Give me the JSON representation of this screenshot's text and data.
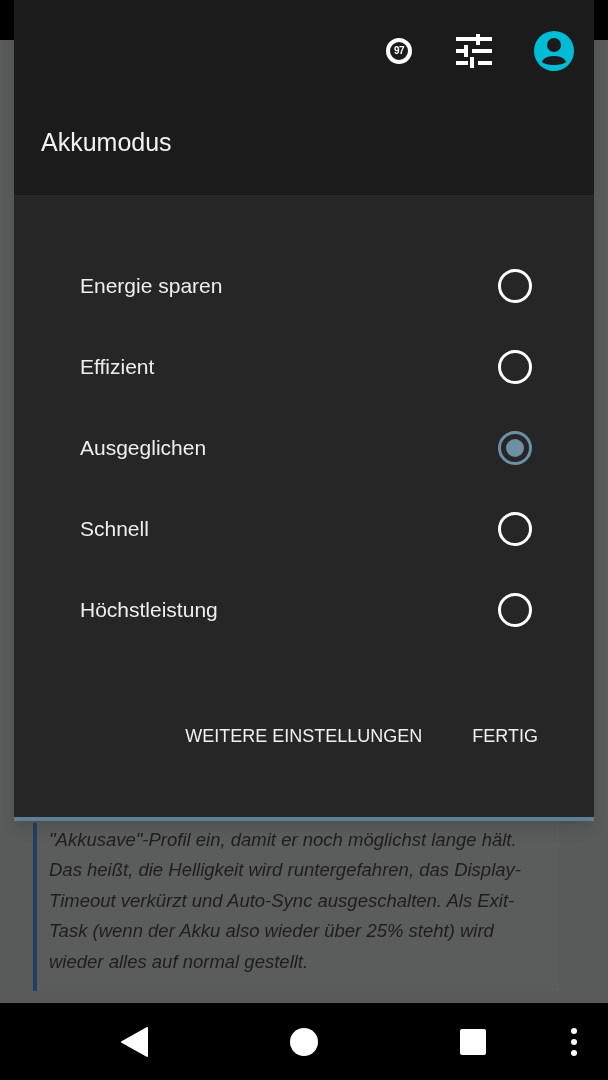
{
  "header": {
    "battery_badge": "97",
    "title": "Akkumodus"
  },
  "options": [
    {
      "label": "Energie sparen",
      "selected": false
    },
    {
      "label": "Effizient",
      "selected": false
    },
    {
      "label": "Ausgeglichen",
      "selected": true
    },
    {
      "label": "Schnell",
      "selected": false
    },
    {
      "label": "Höchstleistung",
      "selected": false
    }
  ],
  "buttons": [
    "WEITERE EINSTELLUNGEN",
    "FERTIG"
  ],
  "background_text": "\"Akkusave\"-Profil ein, damit er noch möglichst lange hält. Das heißt, die Helligkeit wird runtergefahren, das Display-Timeout verkürzt und Auto-Sync ausgeschalten. Als Exit-Task (wenn der Akku also wieder über 25% steht) wird wieder alles auf normal gestellt."
}
